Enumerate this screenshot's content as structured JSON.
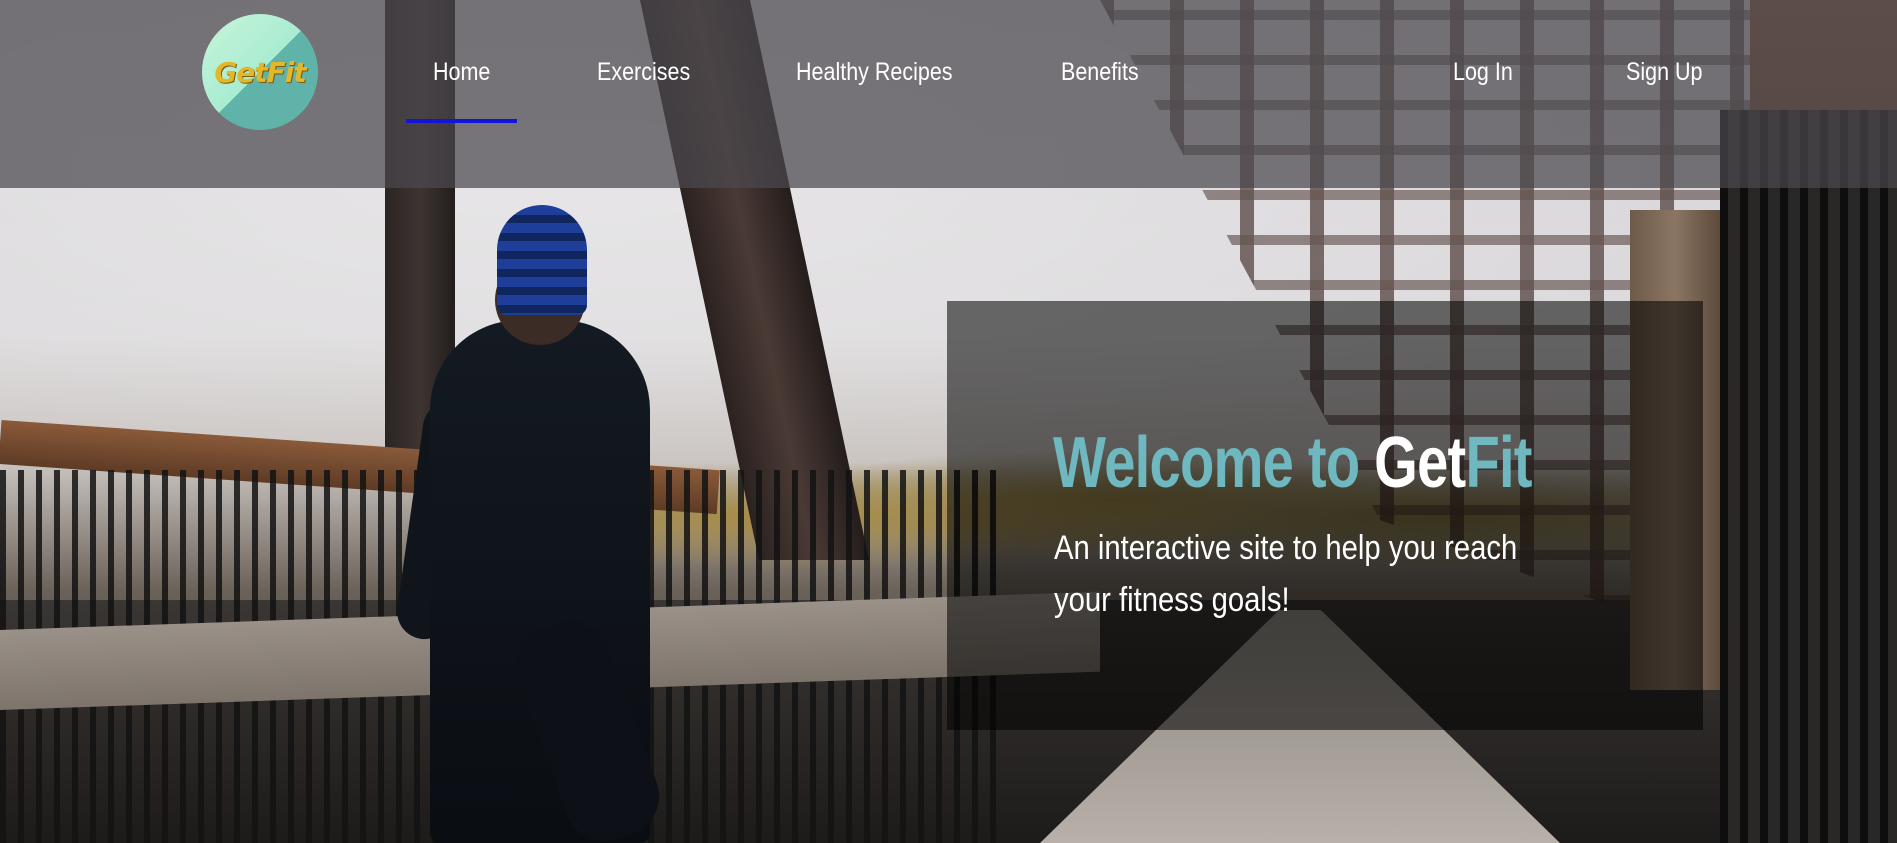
{
  "brand": {
    "logo_text": "GetFit"
  },
  "nav": {
    "links": [
      {
        "label": "Home",
        "active": true
      },
      {
        "label": "Exercises"
      },
      {
        "label": "Healthy Recipes"
      },
      {
        "label": "Benefits"
      }
    ],
    "auth": [
      {
        "label": "Log In"
      },
      {
        "label": "Sign Up"
      }
    ],
    "active_indicator_color": "#1414d8"
  },
  "hero": {
    "title_part1": "Welcome to",
    "title_part2": "Get",
    "title_part3": "Fit",
    "subtitle": "An interactive site to help you reach your fitness goals!",
    "accent_color": "#6fb8bf"
  }
}
